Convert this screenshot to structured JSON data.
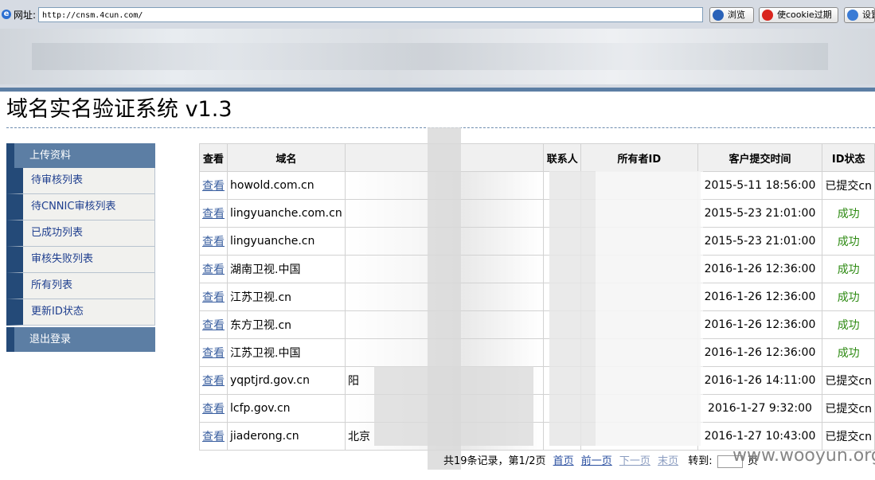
{
  "browser": {
    "address_label": "网址:",
    "url": "http://cnsm.4cun.com/",
    "browse_label": "浏览",
    "cookie_label": "使cookie过期",
    "settings_label": "设置"
  },
  "app": {
    "title": "域名实名验证系统  v1.3"
  },
  "sidebar": {
    "header": "上传资料",
    "items": [
      {
        "label": "待审核列表"
      },
      {
        "label": "待CNNIC审核列表"
      },
      {
        "label": "已成功列表"
      },
      {
        "label": "审核失败列表"
      },
      {
        "label": "所有列表"
      },
      {
        "label": "更新ID状态"
      }
    ],
    "logout": "退出登录"
  },
  "table": {
    "headers": [
      "查看",
      "域名",
      "",
      "联系人",
      "所有者ID",
      "客户提交时间",
      "ID状态"
    ],
    "rows": [
      {
        "view": "查看",
        "domain": "howold.com.cn",
        "owner": "",
        "contact": "",
        "owner_id": "",
        "time": "2015-5-11 18:56:00",
        "status": "已提交cn",
        "status_type": "pending"
      },
      {
        "view": "查看",
        "domain": "lingyuanche.com.cn",
        "owner": "",
        "contact": "",
        "owner_id": "",
        "time": "2015-5-23 21:01:00",
        "status": "成功",
        "status_type": "ok"
      },
      {
        "view": "查看",
        "domain": "lingyuanche.cn",
        "owner": "",
        "contact": "",
        "owner_id": "",
        "time": "2015-5-23 21:01:00",
        "status": "成功",
        "status_type": "ok"
      },
      {
        "view": "查看",
        "domain": "湖南卫视.中国",
        "owner": "",
        "contact": "",
        "owner_id": "",
        "time": "2016-1-26 12:36:00",
        "status": "成功",
        "status_type": "ok"
      },
      {
        "view": "查看",
        "domain": "江苏卫视.cn",
        "owner": "",
        "contact": "",
        "owner_id": "",
        "time": "2016-1-26 12:36:00",
        "status": "成功",
        "status_type": "ok"
      },
      {
        "view": "查看",
        "domain": "东方卫视.cn",
        "owner": "",
        "contact": "",
        "owner_id": "",
        "time": "2016-1-26 12:36:00",
        "status": "成功",
        "status_type": "ok"
      },
      {
        "view": "查看",
        "domain": "江苏卫视.中国",
        "owner": "",
        "contact": "",
        "owner_id": "",
        "time": "2016-1-26 12:36:00",
        "status": "成功",
        "status_type": "ok"
      },
      {
        "view": "查看",
        "domain": "yqptjrd.gov.cn",
        "owner": "阳",
        "contact": "",
        "owner_id": "",
        "time": "2016-1-26 14:11:00",
        "status": "已提交cn",
        "status_type": "pending"
      },
      {
        "view": "查看",
        "domain": "lcfp.gov.cn",
        "owner": "",
        "contact": "",
        "owner_id": "",
        "time": "2016-1-27 9:32:00",
        "status": "已提交cn",
        "status_type": "pending"
      },
      {
        "view": "查看",
        "domain": "jiaderong.cn",
        "owner": "北京",
        "contact": "",
        "owner_id": "",
        "time": "2016-1-27 10:43:00",
        "status": "已提交cn",
        "status_type": "pending"
      }
    ]
  },
  "pager": {
    "summary": "共19条记录，第1/2页",
    "first": "首页",
    "prev": "前一页",
    "next": "下一页",
    "last": "末页",
    "jump": "转到:",
    "page_suffix": "页"
  },
  "watermark": "www.wooyun.org",
  "colors": {
    "sidebar_header": "#5c7ea4",
    "sidebar_accent": "#244a78",
    "success": "#2d8a12",
    "link": "#3a5fa0"
  }
}
